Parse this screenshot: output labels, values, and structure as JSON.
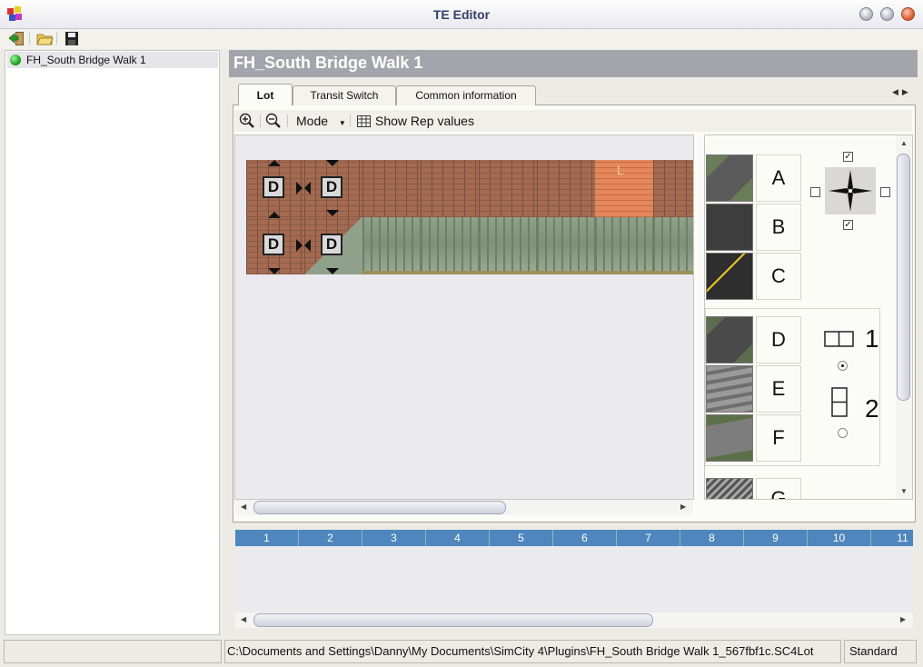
{
  "window": {
    "title": "TE Editor"
  },
  "toolbar": {
    "items": [
      "exit-icon",
      "open-folder-icon",
      "save-icon"
    ]
  },
  "tree": {
    "items": [
      {
        "label": "FH_South Bridge Walk 1",
        "status_color": "#1fa21f"
      }
    ]
  },
  "lot": {
    "title": "FH_South Bridge Walk 1"
  },
  "tabs": [
    {
      "label": "Lot",
      "active": true
    },
    {
      "label": "Transit Switch",
      "active": false
    },
    {
      "label": "Common information",
      "active": false
    }
  ],
  "lot_toolbar": {
    "mode_label": "Mode",
    "show_rep_label": "Show Rep values"
  },
  "grid": {
    "d_label": "D",
    "corner_label": "L"
  },
  "palette": {
    "letters": [
      "A",
      "B",
      "C",
      "D",
      "E",
      "F",
      "G"
    ],
    "orientation_numbers": [
      "1",
      "2"
    ],
    "direction_checks": {
      "top": true,
      "bottom": true,
      "left": false,
      "right": false
    },
    "orientation_selected": "1"
  },
  "bottom_grid": {
    "columns": [
      "1",
      "2",
      "3",
      "4",
      "5",
      "6",
      "7",
      "8",
      "9",
      "10",
      "11"
    ]
  },
  "status": {
    "left": "",
    "path": "C:\\Documents and Settings\\Danny\\My Documents\\SimCity 4\\Plugins\\FH_South Bridge Walk 1_567fbf1c.SC4Lot",
    "mode": "Standard"
  },
  "colors": {
    "header_blue": "#4e86bd",
    "title_blue": "#34406a",
    "panel_grey": "#a4a4ac"
  }
}
